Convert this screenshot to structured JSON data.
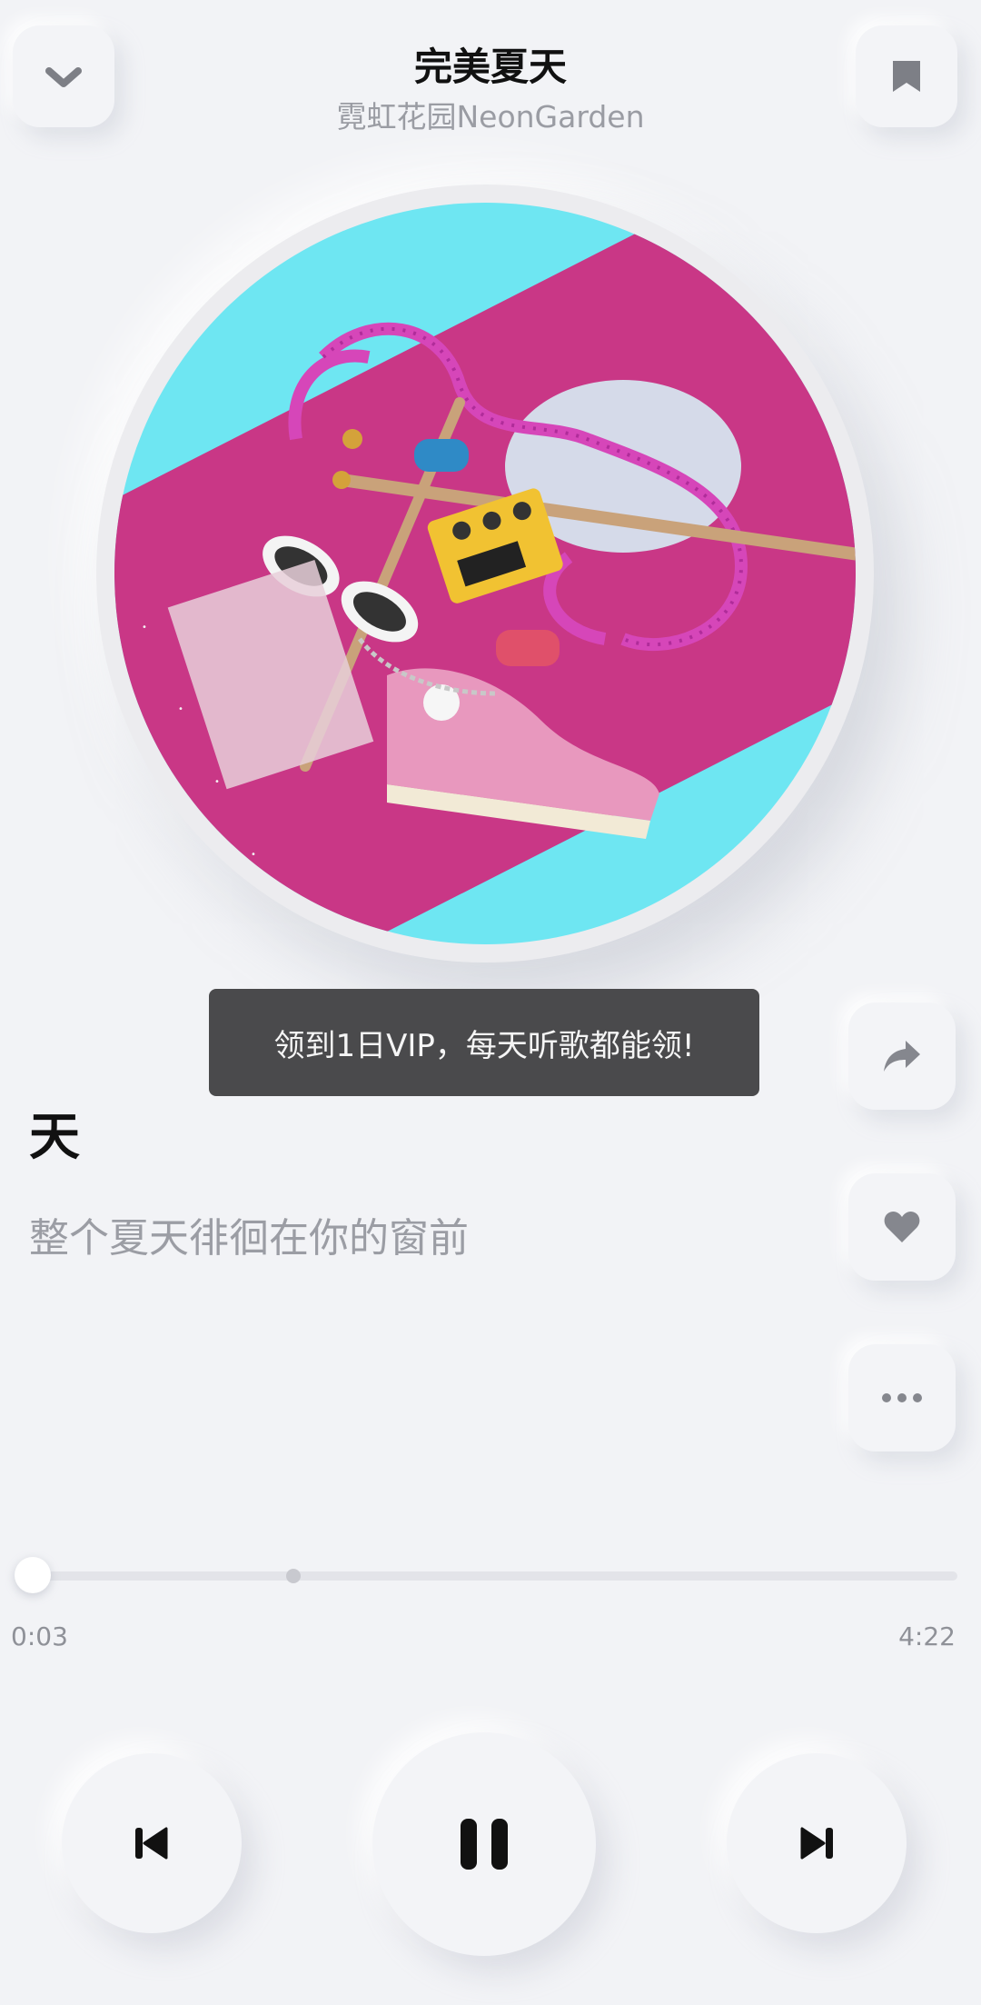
{
  "header": {
    "title": "完美夏天",
    "artist": "霓虹花园NeonGarden"
  },
  "icons": {
    "collapse": "chevron-down-icon",
    "bookmark": "bookmark-icon",
    "share": "share-icon",
    "like": "heart-icon",
    "more": "more-icon",
    "previous": "skip-previous-icon",
    "pause": "pause-icon",
    "next": "skip-next-icon"
  },
  "toast": {
    "text": "领到1日VIP，每天听歌都能领!"
  },
  "lyrics": {
    "current": "天",
    "next": "整个夏天徘徊在你的窗前"
  },
  "progress": {
    "current_time": "0:03",
    "total_time": "4:22",
    "played_fraction": 0.012,
    "buffered_fraction": 0.29
  },
  "colors": {
    "background": "#f2f3f6",
    "art_cyan": "#6ee6f2",
    "art_magenta": "#c0307c",
    "toast_bg": "#4a4a4c"
  }
}
